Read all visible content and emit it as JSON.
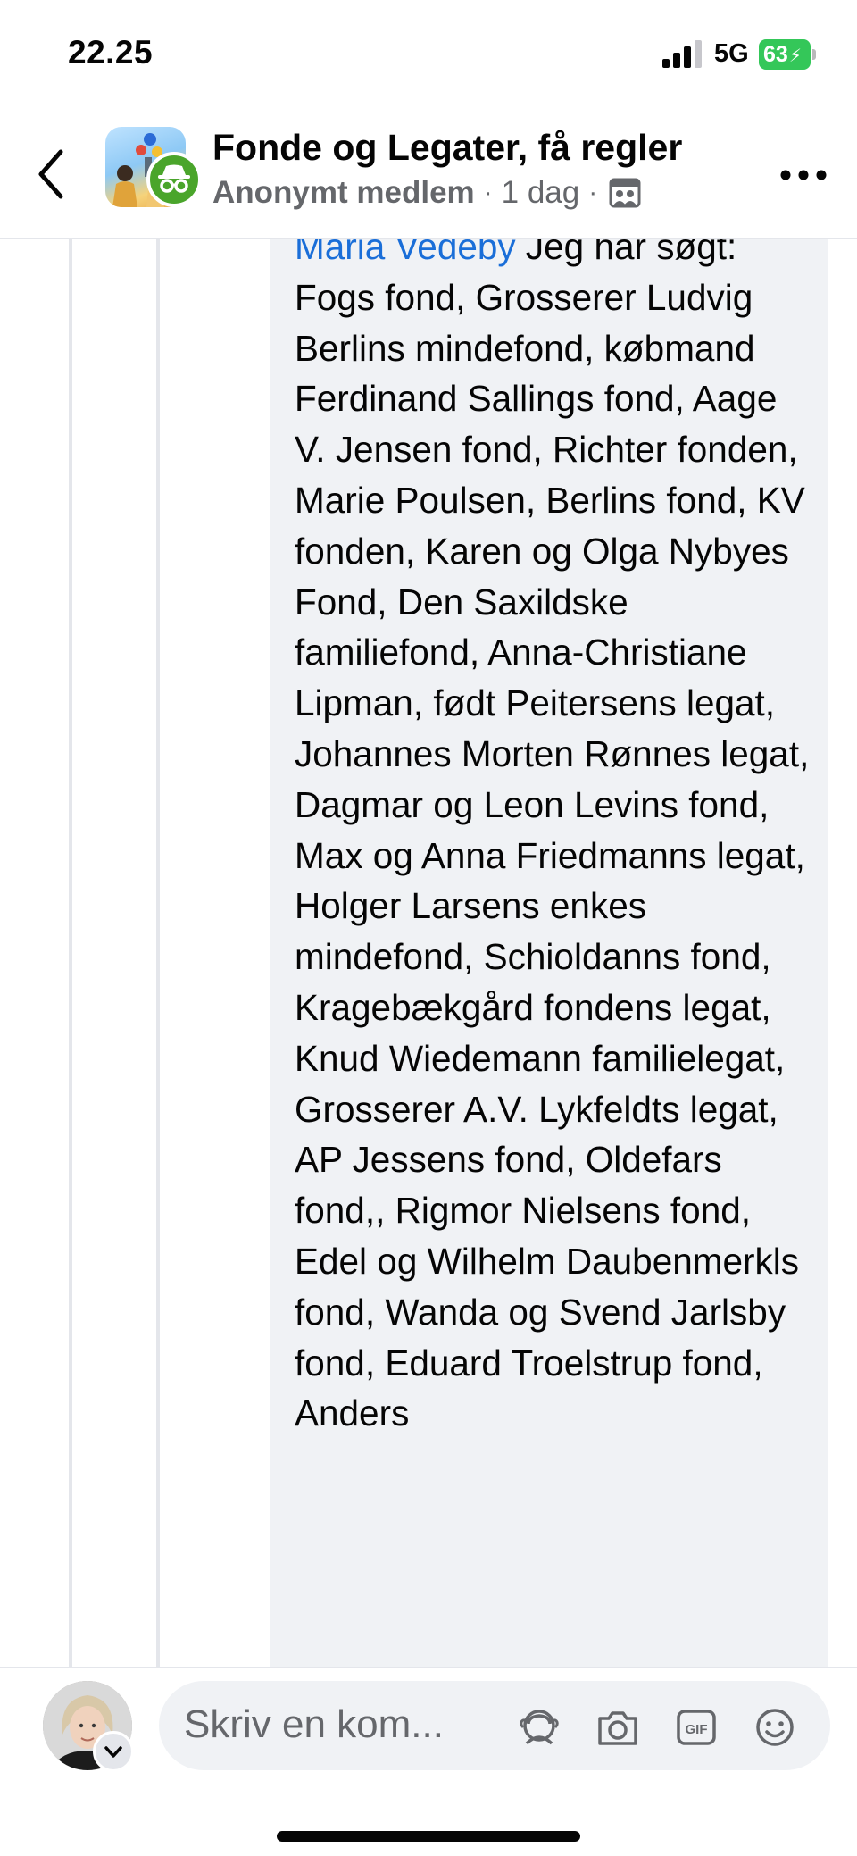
{
  "status_bar": {
    "time": "22.25",
    "network": "5G",
    "battery_percent": "63"
  },
  "header": {
    "group_name": "Fonde og Legater, få regler",
    "author": "Anonymt medlem",
    "separator": "·",
    "age": "1 dag",
    "icons": {
      "back": "chevron-left-icon",
      "anonymous": "incognito-icon",
      "audience": "group-audience-icon",
      "more": "more-dots-icon"
    }
  },
  "comment": {
    "mention": "Maria Vedeby",
    "text": " Jeg har søgt: Fogs fond, Grosserer Ludvig Berlins mindefond, købmand Ferdinand Sallings fond, Aage V. Jensen fond, Richter fonden, Marie Poulsen, Berlins fond, KV fonden, Karen og Olga Nybyes Fond, Den Saxildske familiefond, Anna-Christiane Lipman, født Peitersens legat, Johannes Morten Rønnes legat, Dagmar og Leon Levins fond, Max og Anna Friedmanns legat, Holger Larsens enkes mindefond, Schioldanns fond, Kragebækgård fondens legat, Knud Wiedemann familielegat, Grosserer A.V. Lykfeldts legat, AP Jessens fond, Oldefars fond,, Rigmor Nielsens fond, Edel og Wilhelm Daubenmerkls fond, Wanda og Svend Jarlsby fond, Eduard Troelstrup fond, Anders"
  },
  "composer": {
    "placeholder": "Skriv en kom...",
    "icons": [
      "avatar-reaction-icon",
      "camera-icon",
      "gif-icon",
      "emoji-icon"
    ]
  },
  "colors": {
    "mention": "#1a6ed8",
    "bubble": "#f0f2f5",
    "secondary_text": "#65676b",
    "battery": "#34c759",
    "anon_badge": "#4aa52b"
  }
}
